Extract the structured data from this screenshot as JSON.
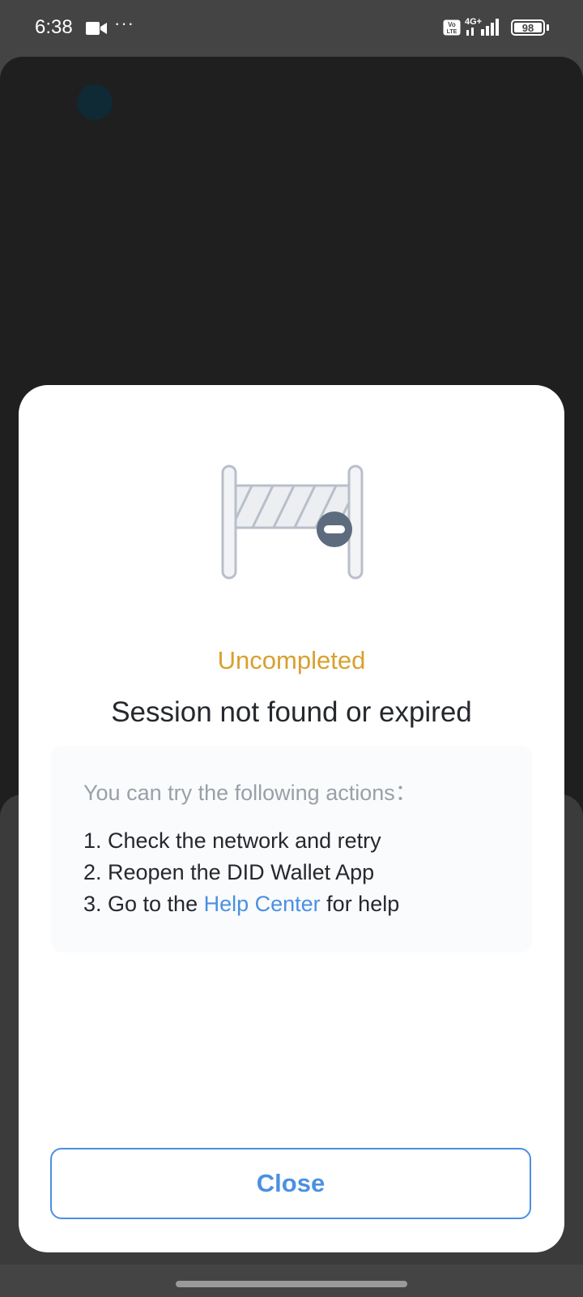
{
  "status_bar": {
    "time": "6:38",
    "dots": "···",
    "volte_label": "Vo LTE",
    "network_label": "4G+",
    "battery_level": "98",
    "icons": [
      "video-camera-icon",
      "more-dots-icon",
      "volte-icon",
      "signal-icon",
      "battery-icon"
    ]
  },
  "modal": {
    "illustration": "barrier-gate-icon",
    "status": "Uncompleted",
    "headline": "Session not found or expired",
    "actions_intro": "You can try the following actions：",
    "actions": {
      "item1": "1. Check the network and retry",
      "item2": "2. Reopen the DID Wallet App",
      "item3_prefix": "3. Go to the ",
      "item3_link": "Help Center",
      "item3_suffix": " for help"
    },
    "close_label": "Close"
  },
  "colors": {
    "status_accent": "#d9a030",
    "link": "#4a90e2",
    "headline": "#25282d",
    "muted": "#9aa0a8",
    "backdrop": "#1f1f1f"
  }
}
